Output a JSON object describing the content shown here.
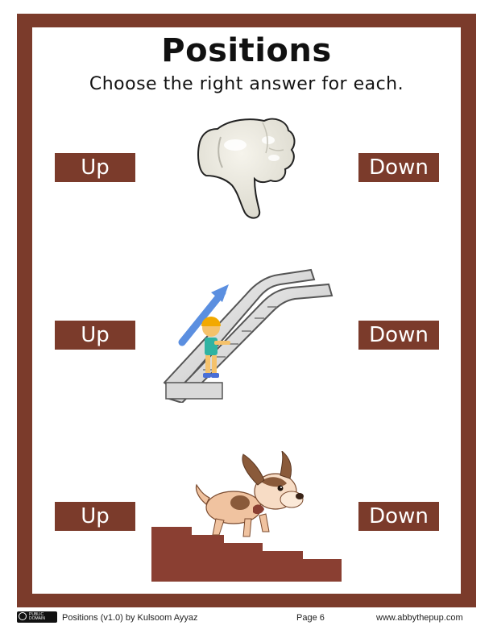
{
  "worksheet": {
    "title": "Positions",
    "instruction": "Choose the right answer for each."
  },
  "questions": [
    {
      "image": "thumbs-down-icon",
      "options": [
        "Up",
        "Down"
      ]
    },
    {
      "image": "escalator-up-icon",
      "options": [
        "Up",
        "Down"
      ]
    },
    {
      "image": "dog-climbing-stairs-icon",
      "options": [
        "Up",
        "Down"
      ]
    }
  ],
  "footer": {
    "license_badge": "PUBLIC DOMAIN",
    "credit": "Positions (v1.0) by Kulsoom Ayyaz",
    "page": "Page 6",
    "website": "www.abbythepup.com"
  },
  "colors": {
    "frame": "#7b3b2b",
    "button": "#7b3b2b",
    "button_text": "#ffffff"
  }
}
